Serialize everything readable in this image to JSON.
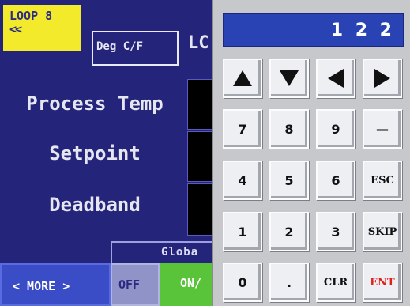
{
  "header": {
    "loop_label": "LOOP 8",
    "loop_arrows": "<<",
    "deg_button": "Deg C/F",
    "partial_title": "LC"
  },
  "rows": [
    {
      "label": "Process Temp"
    },
    {
      "label": "Setpoint"
    },
    {
      "label": "Deadband"
    }
  ],
  "footer": {
    "global_label": "Globa",
    "more_button": "< MORE >",
    "off_button": "OFF",
    "on_button": "ON/"
  },
  "keypad": {
    "display_value": "1 2 2",
    "arrows": [
      "up-arrow-icon",
      "down-arrow-icon",
      "left-arrow-icon",
      "right-arrow-icon"
    ],
    "row1": [
      "7",
      "8",
      "9",
      "—"
    ],
    "row2": [
      "4",
      "5",
      "6",
      "ESC"
    ],
    "row3": [
      "1",
      "2",
      "3",
      "SKIP"
    ],
    "row4": [
      "0",
      ".",
      "CLR",
      "ENT"
    ]
  },
  "colors": {
    "screen_bg": "#24257a",
    "loop_yellow": "#f2ea2a",
    "display_blue": "#2943b5",
    "on_green": "#59c43a",
    "ent_red": "#e0201c"
  }
}
